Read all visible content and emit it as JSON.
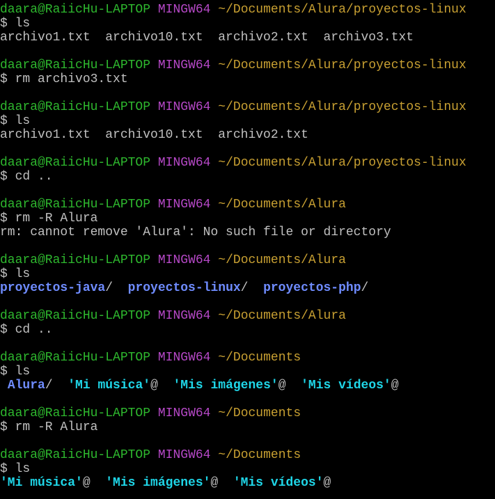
{
  "terminal": {
    "user_host": "daara@RaiicHu-LAPTOP",
    "shell": "MINGW64",
    "colors": {
      "background": "#000000",
      "foreground": "#c0c0c0",
      "user_host": "#2eb82e",
      "shell": "#b548c6",
      "path": "#c8a032",
      "directory": "#6f8cff",
      "symlink": "#1fd6e8"
    },
    "lines": [
      {
        "type": "prompt",
        "user": "daara@RaiicHu-LAPTOP",
        "shell": "MINGW64",
        "path": "~/Documents/Alura/proyectos-linux"
      },
      {
        "type": "command",
        "text": "$ ls"
      },
      {
        "type": "output",
        "segments": [
          {
            "text": "archivo1.txt  archivo10.txt  archivo2.txt  archivo3.txt",
            "style": "plain"
          }
        ]
      },
      {
        "type": "blank"
      },
      {
        "type": "prompt",
        "user": "daara@RaiicHu-LAPTOP",
        "shell": "MINGW64",
        "path": "~/Documents/Alura/proyectos-linux"
      },
      {
        "type": "command",
        "text": "$ rm archivo3.txt"
      },
      {
        "type": "blank"
      },
      {
        "type": "prompt",
        "user": "daara@RaiicHu-LAPTOP",
        "shell": "MINGW64",
        "path": "~/Documents/Alura/proyectos-linux"
      },
      {
        "type": "command",
        "text": "$ ls"
      },
      {
        "type": "output",
        "segments": [
          {
            "text": "archivo1.txt  archivo10.txt  archivo2.txt",
            "style": "plain"
          }
        ]
      },
      {
        "type": "blank"
      },
      {
        "type": "prompt",
        "user": "daara@RaiicHu-LAPTOP",
        "shell": "MINGW64",
        "path": "~/Documents/Alura/proyectos-linux"
      },
      {
        "type": "command",
        "text": "$ cd .."
      },
      {
        "type": "blank"
      },
      {
        "type": "prompt",
        "user": "daara@RaiicHu-LAPTOP",
        "shell": "MINGW64",
        "path": "~/Documents/Alura"
      },
      {
        "type": "command",
        "text": "$ rm -R Alura"
      },
      {
        "type": "output",
        "segments": [
          {
            "text": "rm: cannot remove 'Alura': No such file or directory",
            "style": "plain"
          }
        ]
      },
      {
        "type": "blank"
      },
      {
        "type": "prompt",
        "user": "daara@RaiicHu-LAPTOP",
        "shell": "MINGW64",
        "path": "~/Documents/Alura"
      },
      {
        "type": "command",
        "text": "$ ls"
      },
      {
        "type": "output",
        "segments": [
          {
            "text": "proyectos-java",
            "style": "dir"
          },
          {
            "text": "/  ",
            "style": "plain"
          },
          {
            "text": "proyectos-linux",
            "style": "dir"
          },
          {
            "text": "/  ",
            "style": "plain"
          },
          {
            "text": "proyectos-php",
            "style": "dir"
          },
          {
            "text": "/",
            "style": "plain"
          }
        ]
      },
      {
        "type": "blank"
      },
      {
        "type": "prompt",
        "user": "daara@RaiicHu-LAPTOP",
        "shell": "MINGW64",
        "path": "~/Documents/Alura"
      },
      {
        "type": "command",
        "text": "$ cd .."
      },
      {
        "type": "blank"
      },
      {
        "type": "prompt",
        "user": "daara@RaiicHu-LAPTOP",
        "shell": "MINGW64",
        "path": "~/Documents"
      },
      {
        "type": "command",
        "text": "$ ls"
      },
      {
        "type": "output",
        "segments": [
          {
            "text": " ",
            "style": "plain"
          },
          {
            "text": "Alura",
            "style": "dir"
          },
          {
            "text": "/  ",
            "style": "plain"
          },
          {
            "text": "'Mi música'",
            "style": "link"
          },
          {
            "text": "@  ",
            "style": "plain"
          },
          {
            "text": "'Mis imágenes'",
            "style": "link"
          },
          {
            "text": "@  ",
            "style": "plain"
          },
          {
            "text": "'Mis vídeos'",
            "style": "link"
          },
          {
            "text": "@",
            "style": "plain"
          }
        ]
      },
      {
        "type": "blank"
      },
      {
        "type": "prompt",
        "user": "daara@RaiicHu-LAPTOP",
        "shell": "MINGW64",
        "path": "~/Documents"
      },
      {
        "type": "command",
        "text": "$ rm -R Alura"
      },
      {
        "type": "blank"
      },
      {
        "type": "prompt",
        "user": "daara@RaiicHu-LAPTOP",
        "shell": "MINGW64",
        "path": "~/Documents"
      },
      {
        "type": "command",
        "text": "$ ls"
      },
      {
        "type": "output",
        "segments": [
          {
            "text": "'Mi música'",
            "style": "link"
          },
          {
            "text": "@  ",
            "style": "plain"
          },
          {
            "text": "'Mis imágenes'",
            "style": "link"
          },
          {
            "text": "@  ",
            "style": "plain"
          },
          {
            "text": "'Mis vídeos'",
            "style": "link"
          },
          {
            "text": "@",
            "style": "plain"
          }
        ]
      }
    ]
  }
}
